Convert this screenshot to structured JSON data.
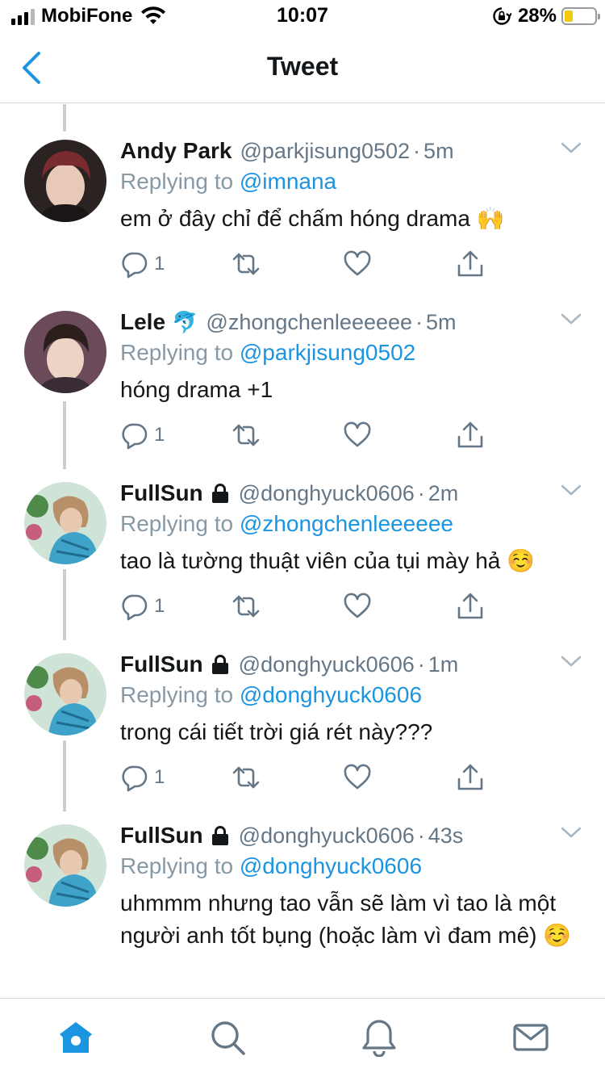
{
  "status_bar": {
    "carrier": "MobiFone",
    "time": "10:07",
    "battery_percent": "28%",
    "battery_level": 0.28,
    "battery_color": "#f3c90e",
    "signal_bars_active": 3
  },
  "nav": {
    "title": "Tweet",
    "back_icon": "chevron-left-icon"
  },
  "colors": {
    "accent": "#1b95e0",
    "secondary_text": "#657786",
    "reply_text": "#8899a6",
    "thread_line": "#c4cfd6"
  },
  "tweets": [
    {
      "name": "Andy Park",
      "badge": "",
      "handle": "@parkjisung0502",
      "dot": "·",
      "time": "5m",
      "replying_label": "Replying to",
      "replying_to": "@imnana",
      "text": "em ở đây chỉ để chấm hóng drama 🙌",
      "reply_count": "1"
    },
    {
      "name": "Lele",
      "badge": "🐬",
      "handle": "@zhongchenleeeeee",
      "dot": "·",
      "time": "5m",
      "replying_label": "Replying to",
      "replying_to": "@parkjisung0502",
      "text": "hóng drama +1",
      "reply_count": "1"
    },
    {
      "name": "FullSun",
      "badge": "lock",
      "handle": "@donghyuck0606",
      "dot": "·",
      "time": "2m",
      "replying_label": "Replying to",
      "replying_to": "@zhongchenleeeeee",
      "text": "tao là tường thuật viên của tụi mày hả ☺️",
      "reply_count": "1"
    },
    {
      "name": "FullSun",
      "badge": "lock",
      "handle": "@donghyuck0606",
      "dot": "·",
      "time": "1m",
      "replying_label": "Replying to",
      "replying_to": "@donghyuck0606",
      "text": "trong cái tiết trời giá rét này???",
      "reply_count": "1"
    },
    {
      "name": "FullSun",
      "badge": "lock",
      "handle": "@donghyuck0606",
      "dot": "·",
      "time": "43s",
      "replying_label": "Replying to",
      "replying_to": "@donghyuck0606",
      "text": "uhmmm nhưng tao vẫn sẽ làm vì tao là một người anh tốt bụng (hoặc làm vì đam mê) ☺️",
      "reply_count": ""
    }
  ],
  "tabs": [
    "home-icon",
    "search-icon",
    "notifications-icon",
    "messages-icon"
  ]
}
